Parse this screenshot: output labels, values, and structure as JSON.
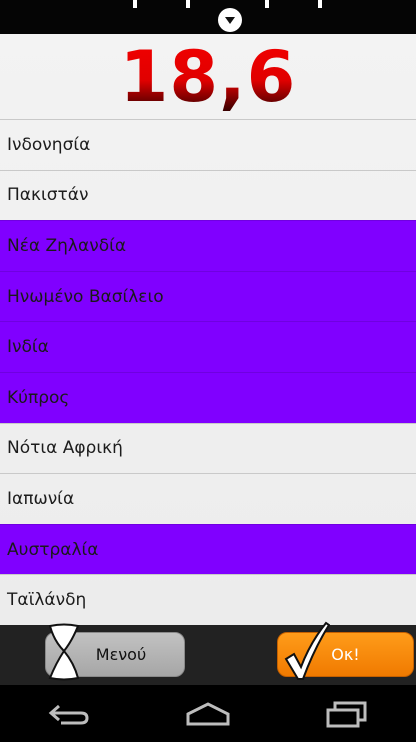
{
  "score": "18,6",
  "list": {
    "items": [
      {
        "label": "Ινδονησία",
        "selected": false
      },
      {
        "label": "Πακιστάν",
        "selected": false
      },
      {
        "label": "Νέα Ζηλανδία",
        "selected": true
      },
      {
        "label": "Ηνωμένο Βασίλειο",
        "selected": true
      },
      {
        "label": "Ινδία",
        "selected": true
      },
      {
        "label": "Κύπρος",
        "selected": true
      },
      {
        "label": "Νότια Αφρική",
        "selected": false
      },
      {
        "label": "Ιαπωνία",
        "selected": false
      },
      {
        "label": "Αυστραλία",
        "selected": true
      },
      {
        "label": "Ταϊλάνδη",
        "selected": false
      }
    ]
  },
  "buttons": {
    "menu_label": "Μενού",
    "ok_label": "Οκ!"
  },
  "colors": {
    "selected_row": "#8000ff",
    "score_red": "#e00000",
    "ok_orange": "#f58a00",
    "menu_gray": "#b4b4b4"
  },
  "icons": {
    "top": "chevron-down-icon",
    "menu": "hourglass-icon",
    "ok": "checkmark-icon",
    "nav": [
      "back-icon",
      "home-icon",
      "recent-apps-icon"
    ]
  }
}
